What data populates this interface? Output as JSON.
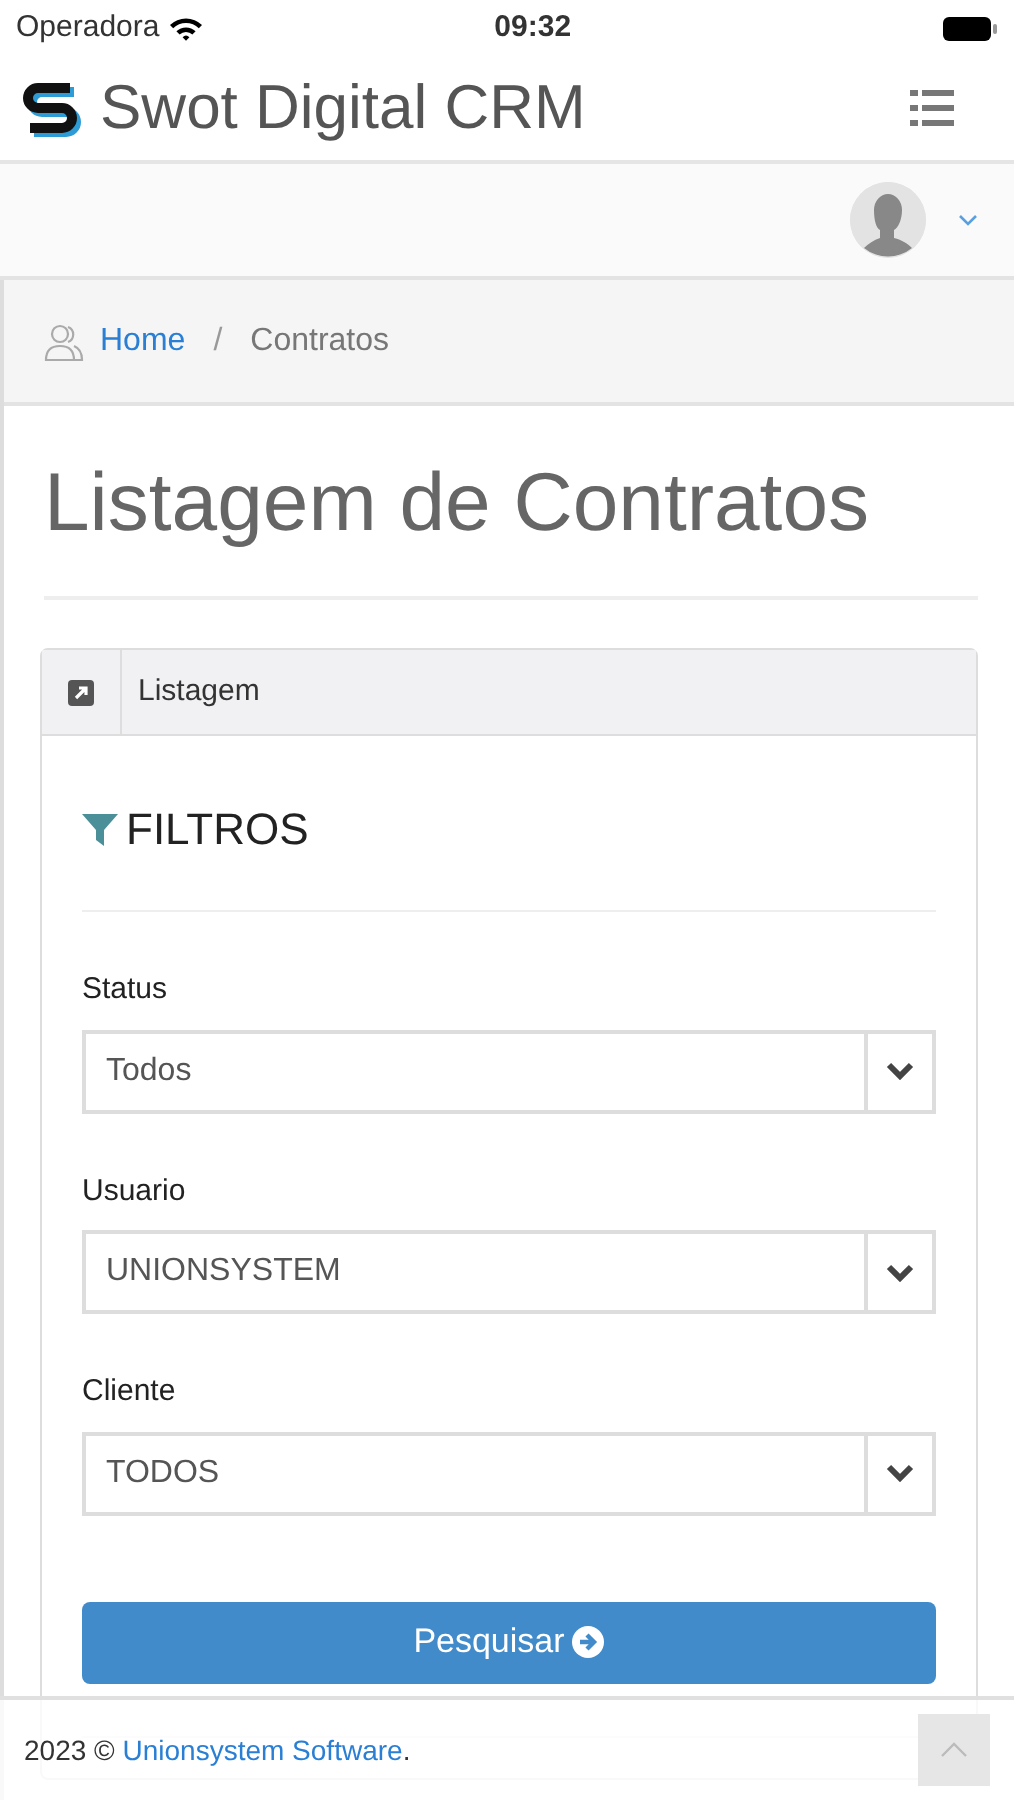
{
  "status_bar": {
    "carrier": "Operadora",
    "time": "09:32"
  },
  "navbar": {
    "brand": "Swot Digital CRM"
  },
  "breadcrumb": {
    "separator": "/",
    "items": [
      {
        "label": "Home",
        "kind": "link"
      },
      {
        "label": "Contratos",
        "kind": "current"
      }
    ]
  },
  "page_title": "Listagem de Contratos",
  "panel": {
    "title": "Listagem",
    "filters_title": "FILTROS",
    "fields": [
      {
        "label": "Status",
        "value": "Todos"
      },
      {
        "label": "Usuario",
        "value": "UNIONSYSTEM"
      },
      {
        "label": "Cliente",
        "value": "TODOS"
      }
    ],
    "search_button": "Pesquisar"
  },
  "footer": {
    "text_before": "2023 ©",
    "link": "Unionsystem Software",
    "text_after": "."
  }
}
